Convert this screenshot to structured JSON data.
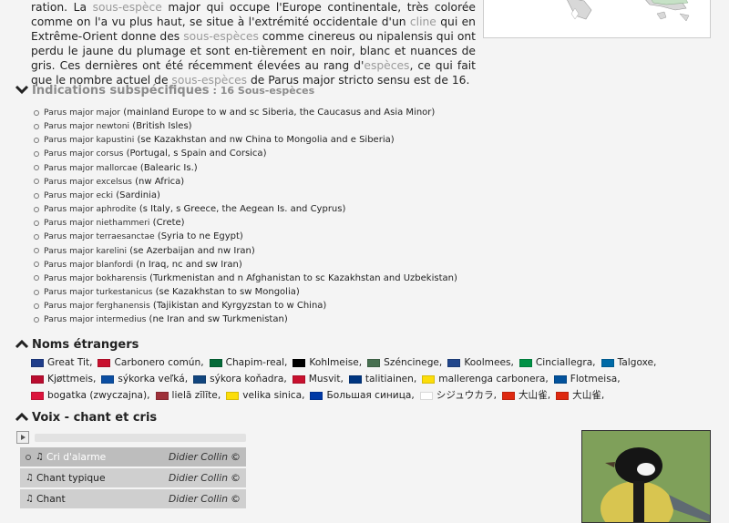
{
  "intro": {
    "l1_a": "ration. La ",
    "l1_link": "sous-espèce",
    "l1_b": " major qui occupe l'Europe continentale, très colorée comme on l'a",
    "l2_a": "vu plus haut, se situe à l'extrémité occidentale d'un ",
    "l2_link": "cline",
    "l2_b": " qui en Extrême-Orient donne des",
    "l3_link": "sous-espèces",
    "l3_b": " comme cinereus ou nipalensis qui ont perdu le jaune du plumage et sont en-",
    "l4_a": "tièrement en noir, blanc et nuances de gris. Ces dernières ont été récemment élevées au rang d'",
    "l4_link": "espèces",
    "l4_b": ", ce qui fait que le nombre actuel",
    "l5_a": "de ",
    "l5_link": "sous-espèces",
    "l5_b": " de Parus major stricto sensu est de 16."
  },
  "subspecies": {
    "title": "Indications subspécifiques",
    "count": ": 16 Sous-espèces",
    "items": [
      {
        "sci": "Parus major major",
        "range": "(mainland Europe to w and sc Siberia, the Caucasus and Asia Minor)"
      },
      {
        "sci": "Parus major newtoni",
        "range": "(British Isles)"
      },
      {
        "sci": "Parus major kapustini",
        "range": "(se Kazakhstan and nw China to Mongolia and e Siberia)"
      },
      {
        "sci": "Parus major corsus",
        "range": "(Portugal, s Spain and Corsica)"
      },
      {
        "sci": "Parus major mallorcae",
        "range": "(Balearic Is.)"
      },
      {
        "sci": "Parus major excelsus",
        "range": "(nw Africa)"
      },
      {
        "sci": "Parus major ecki",
        "range": "(Sardinia)"
      },
      {
        "sci": "Parus major aphrodite",
        "range": "(s Italy, s Greece, the Aegean Is. and Cyprus)"
      },
      {
        "sci": "Parus major niethammeri",
        "range": "(Crete)"
      },
      {
        "sci": "Parus major terraesanctae",
        "range": "(Syria to ne Egypt)"
      },
      {
        "sci": "Parus major karelini",
        "range": "(se Azerbaijan and nw Iran)"
      },
      {
        "sci": "Parus major blanfordi",
        "range": "(n Iraq, nc and sw Iran)"
      },
      {
        "sci": "Parus major bokharensis",
        "range": "(Turkmenistan and n Afghanistan to sc Kazakhstan and Uzbekistan)"
      },
      {
        "sci": "Parus major turkestanicus",
        "range": "(se Kazakhstan to sw Mongolia)"
      },
      {
        "sci": "Parus major ferghanensis",
        "range": "(Tajikistan and Kyrgyzstan to w China)"
      },
      {
        "sci": "Parus major intermedius",
        "range": "(ne Iran and sw Turkmenistan)"
      }
    ]
  },
  "foreign": {
    "title": "Noms étrangers",
    "names": [
      {
        "name": "Great Tit,",
        "flag": "uk"
      },
      {
        "name": "Carbonero común,",
        "flag": "es"
      },
      {
        "name": "Chapim-real,",
        "flag": "pt"
      },
      {
        "name": "Kohlmeise,",
        "flag": "de"
      },
      {
        "name": "Széncinege,",
        "flag": "hu"
      },
      {
        "name": "Koolmees,",
        "flag": "nl"
      },
      {
        "name": "Cinciallegra,",
        "flag": "it"
      },
      {
        "name": "Talgoxe,",
        "flag": "se"
      },
      {
        "name": "Kjøttmeis,",
        "flag": "no"
      },
      {
        "name": "sýkorka veľká,",
        "flag": "sk"
      },
      {
        "name": "sýkora koňadra,",
        "flag": "cz"
      },
      {
        "name": "Musvit,",
        "flag": "dk"
      },
      {
        "name": "talitiainen,",
        "flag": "fi"
      },
      {
        "name": "mallerenga carbonera,",
        "flag": "ca"
      },
      {
        "name": "Flotmeisa,",
        "flag": "is"
      },
      {
        "name": "bogatka (zwyczajna),",
        "flag": "pl"
      },
      {
        "name": "lielā zīlīte,",
        "flag": "lv"
      },
      {
        "name": "velika sinica,",
        "flag": "ca"
      },
      {
        "name": "Большая синица,",
        "flag": "ru"
      },
      {
        "name": "シジュウカラ,",
        "flag": "jp"
      },
      {
        "name": "大山雀,",
        "flag": "cn"
      },
      {
        "name": "大山雀,",
        "flag": "cn"
      }
    ]
  },
  "voice": {
    "title": "Voix - chant et cris",
    "tracks": [
      {
        "name": "Cri d'alarme",
        "author": "Didier Collin",
        "copy": "©"
      },
      {
        "name": "Chant typique",
        "author": "Didier Collin",
        "copy": "©"
      },
      {
        "name": "Chant",
        "author": "Didier Collin",
        "copy": "©"
      }
    ]
  },
  "colors": {
    "uk": "#1f3d8a",
    "es": "#c8102e",
    "pt": "#046a38",
    "de": "#000000",
    "hu": "#477050",
    "nl": "#21468b",
    "it": "#009246",
    "se": "#006aa7",
    "no": "#ba0c2f",
    "sk": "#0b4ea2",
    "cz": "#11457e",
    "dk": "#c8102e",
    "fi": "#003580",
    "ca": "#fcdd09",
    "is": "#02529c",
    "pl": "#dc143c",
    "lv": "#9e3039",
    "ru": "#0039a6",
    "jp": "#ffffff",
    "cn": "#de2910"
  }
}
